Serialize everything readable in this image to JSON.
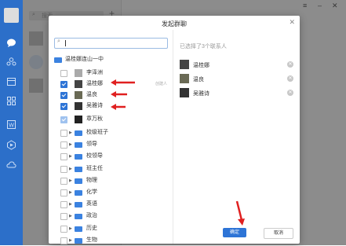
{
  "app": {
    "search_placeholder": "搜索"
  },
  "sidebar": {
    "icons": [
      "chat-icon",
      "contacts-icon",
      "calendar-icon",
      "apps-icon",
      "word-icon",
      "play-icon",
      "cloud-icon"
    ]
  },
  "dialog": {
    "title": "发起群聊",
    "root_folder": "温桂娜连山一中",
    "watermark_tag": "创建人",
    "people": [
      {
        "name": "李泽洲",
        "checked": false
      },
      {
        "name": "温桂娜",
        "checked": true
      },
      {
        "name": "温良",
        "checked": true
      },
      {
        "name": "吴雅诗",
        "checked": true
      },
      {
        "name": "章万秋",
        "checked": true,
        "disabled": true
      }
    ],
    "departments": [
      "校级班子",
      "领导",
      "校领导",
      "班主任",
      "物理",
      "化学",
      "英语",
      "政治",
      "历史",
      "生物"
    ],
    "selected_header": "已选择了3个联系人",
    "selected": [
      "温桂娜",
      "温良",
      "吴雅诗"
    ],
    "ok_label": "确定",
    "cancel_label": "取消"
  },
  "colors": {
    "accent": "#2d74d6",
    "arrow": "#e02020",
    "sidebar": "#2c6fc9"
  }
}
